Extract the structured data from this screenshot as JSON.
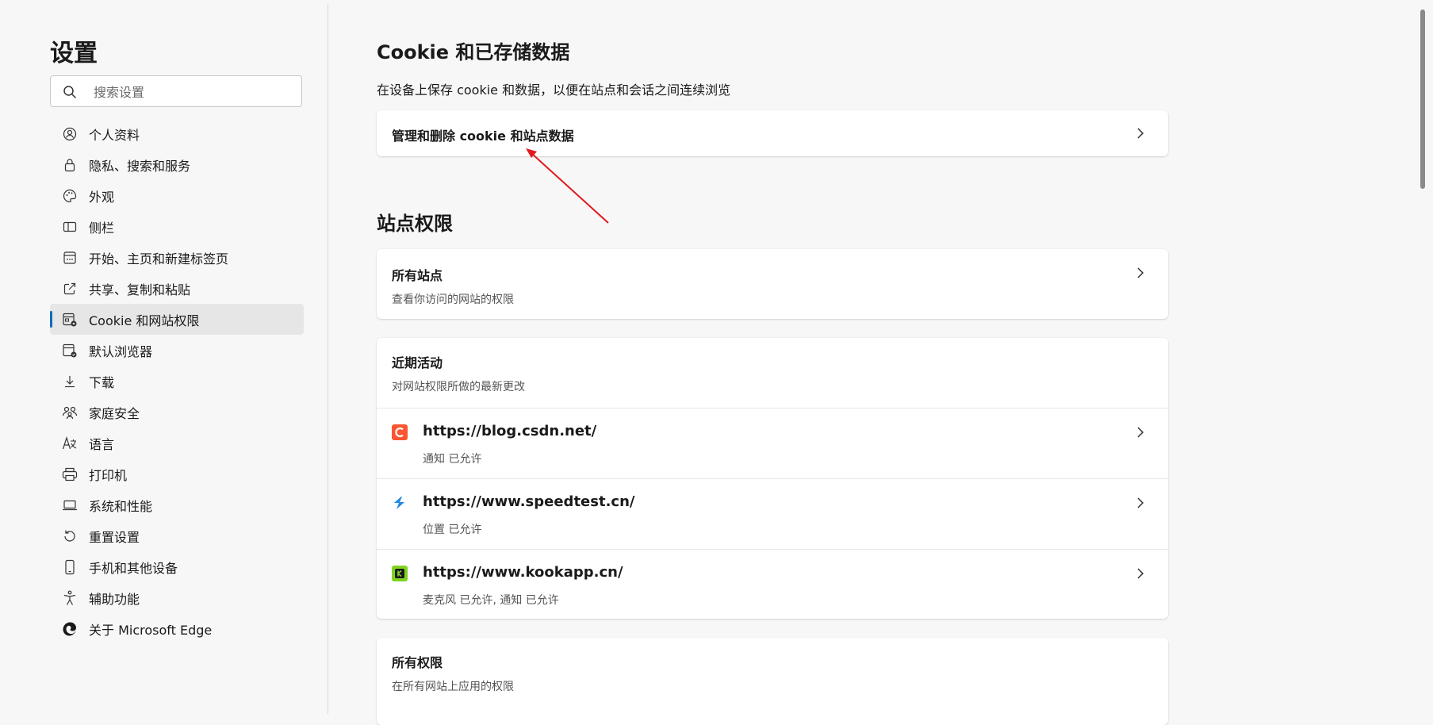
{
  "sidebar": {
    "title": "设置",
    "search_placeholder": "搜索设置",
    "items": [
      {
        "label": "个人资料",
        "icon": "profile-icon"
      },
      {
        "label": "隐私、搜索和服务",
        "icon": "lock-icon"
      },
      {
        "label": "外观",
        "icon": "palette-icon"
      },
      {
        "label": "侧栏",
        "icon": "sidebar-icon"
      },
      {
        "label": "开始、主页和新建标签页",
        "icon": "newtab-icon"
      },
      {
        "label": "共享、复制和粘贴",
        "icon": "share-icon"
      },
      {
        "label": "Cookie 和网站权限",
        "icon": "cookie-settings-icon",
        "active": true
      },
      {
        "label": "默认浏览器",
        "icon": "browser-icon"
      },
      {
        "label": "下载",
        "icon": "download-icon"
      },
      {
        "label": "家庭安全",
        "icon": "family-icon"
      },
      {
        "label": "语言",
        "icon": "language-icon"
      },
      {
        "label": "打印机",
        "icon": "printer-icon"
      },
      {
        "label": "系统和性能",
        "icon": "laptop-icon"
      },
      {
        "label": "重置设置",
        "icon": "reset-icon"
      },
      {
        "label": "手机和其他设备",
        "icon": "phone-icon"
      },
      {
        "label": "辅助功能",
        "icon": "accessibility-icon"
      },
      {
        "label": "关于 Microsoft Edge",
        "icon": "edge-logo-icon"
      }
    ]
  },
  "main": {
    "cookie_section": {
      "title": "Cookie 和已存储数据",
      "subtitle": "在设备上保存 cookie 和数据，以便在站点和会话之间连续浏览",
      "manage_row": "管理和删除 cookie 和站点数据"
    },
    "permissions_section": {
      "title": "站点权限",
      "all_sites": {
        "title": "所有站点",
        "subtitle": "查看你访问的网站的权限"
      },
      "recent": {
        "title": "近期活动",
        "subtitle": "对网站权限所做的最新更改",
        "sites": [
          {
            "url": "https://blog.csdn.net/",
            "status": "通知 已允许",
            "icon": "csdn-icon",
            "color": "#fc5531"
          },
          {
            "url": "https://www.speedtest.cn/",
            "status": "位置 已允许",
            "icon": "speedtest-icon",
            "color": "#1e88e5"
          },
          {
            "url": "https://www.kookapp.cn/",
            "status": "麦克风 已允许, 通知 已允许",
            "icon": "kook-icon",
            "color": "#7ed321"
          }
        ]
      },
      "all_permissions": {
        "title": "所有权限",
        "subtitle": "在所有网站上应用的权限"
      }
    }
  },
  "colors": {
    "accent": "#0f6cbd",
    "annotation_arrow": "#e0191d"
  }
}
